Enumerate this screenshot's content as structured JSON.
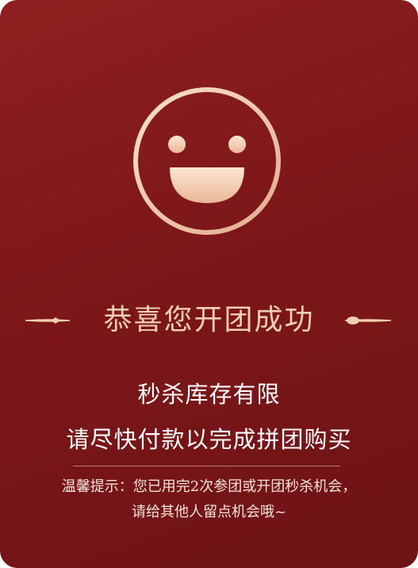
{
  "dialog": {
    "icon": "smiley-face-icon",
    "title": "恭喜您开团成功",
    "message_line1": "秒杀库存有限",
    "message_line2": "请尽快付款以完成拼团购买",
    "tip_line1": "温馨提示：您已用完2次参团或开团秒杀机会，",
    "tip_line2": "请给其他人留点机会哦~"
  },
  "colors": {
    "background": "#7d1719",
    "accent_gold": "#f2cfb0",
    "text_white": "#ffffff"
  }
}
